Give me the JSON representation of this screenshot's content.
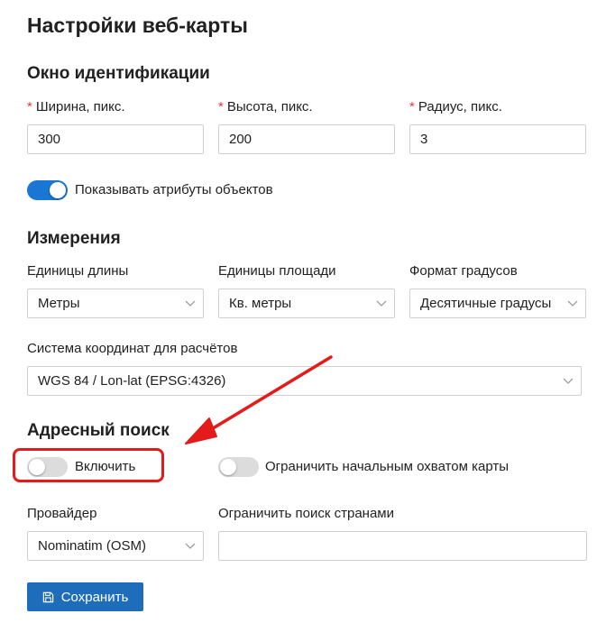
{
  "page": {
    "title": "Настройки веб-карты"
  },
  "identify": {
    "title": "Окно идентификации",
    "width_label": "Ширина, пикс.",
    "width_value": "300",
    "height_label": "Высота, пикс.",
    "height_value": "200",
    "radius_label": "Радиус, пикс.",
    "radius_value": "3",
    "required_mark": "*",
    "show_attributes_label": "Показывать атрибуты объектов",
    "show_attributes_on": true
  },
  "measure": {
    "title": "Измерения",
    "length_units_label": "Единицы длины",
    "length_units_value": "Метры",
    "area_units_label": "Единицы площади",
    "area_units_value": "Кв. метры",
    "degree_format_label": "Формат градусов",
    "degree_format_value": "Десятичные градусы",
    "srs_label": "Система координат для расчётов",
    "srs_value": "WGS 84 / Lon-lat (EPSG:4326)"
  },
  "address_search": {
    "title": "Адресный поиск",
    "enable_label": "Включить",
    "enable_on": false,
    "limit_extent_label": "Ограничить начальным охватом карты",
    "limit_extent_on": false,
    "provider_label": "Провайдер",
    "provider_value": "Nominatim (OSM)",
    "countries_label": "Ограничить поиск странами",
    "countries_value": ""
  },
  "actions": {
    "save_label": "Сохранить"
  },
  "colors": {
    "accent": "#1976d2",
    "button": "#1e6dbb",
    "required": "#e53935",
    "annotation": "#e31b1b"
  },
  "icons": {
    "save": "floppy-disk-icon",
    "dropdown": "chevron-down-icon"
  }
}
